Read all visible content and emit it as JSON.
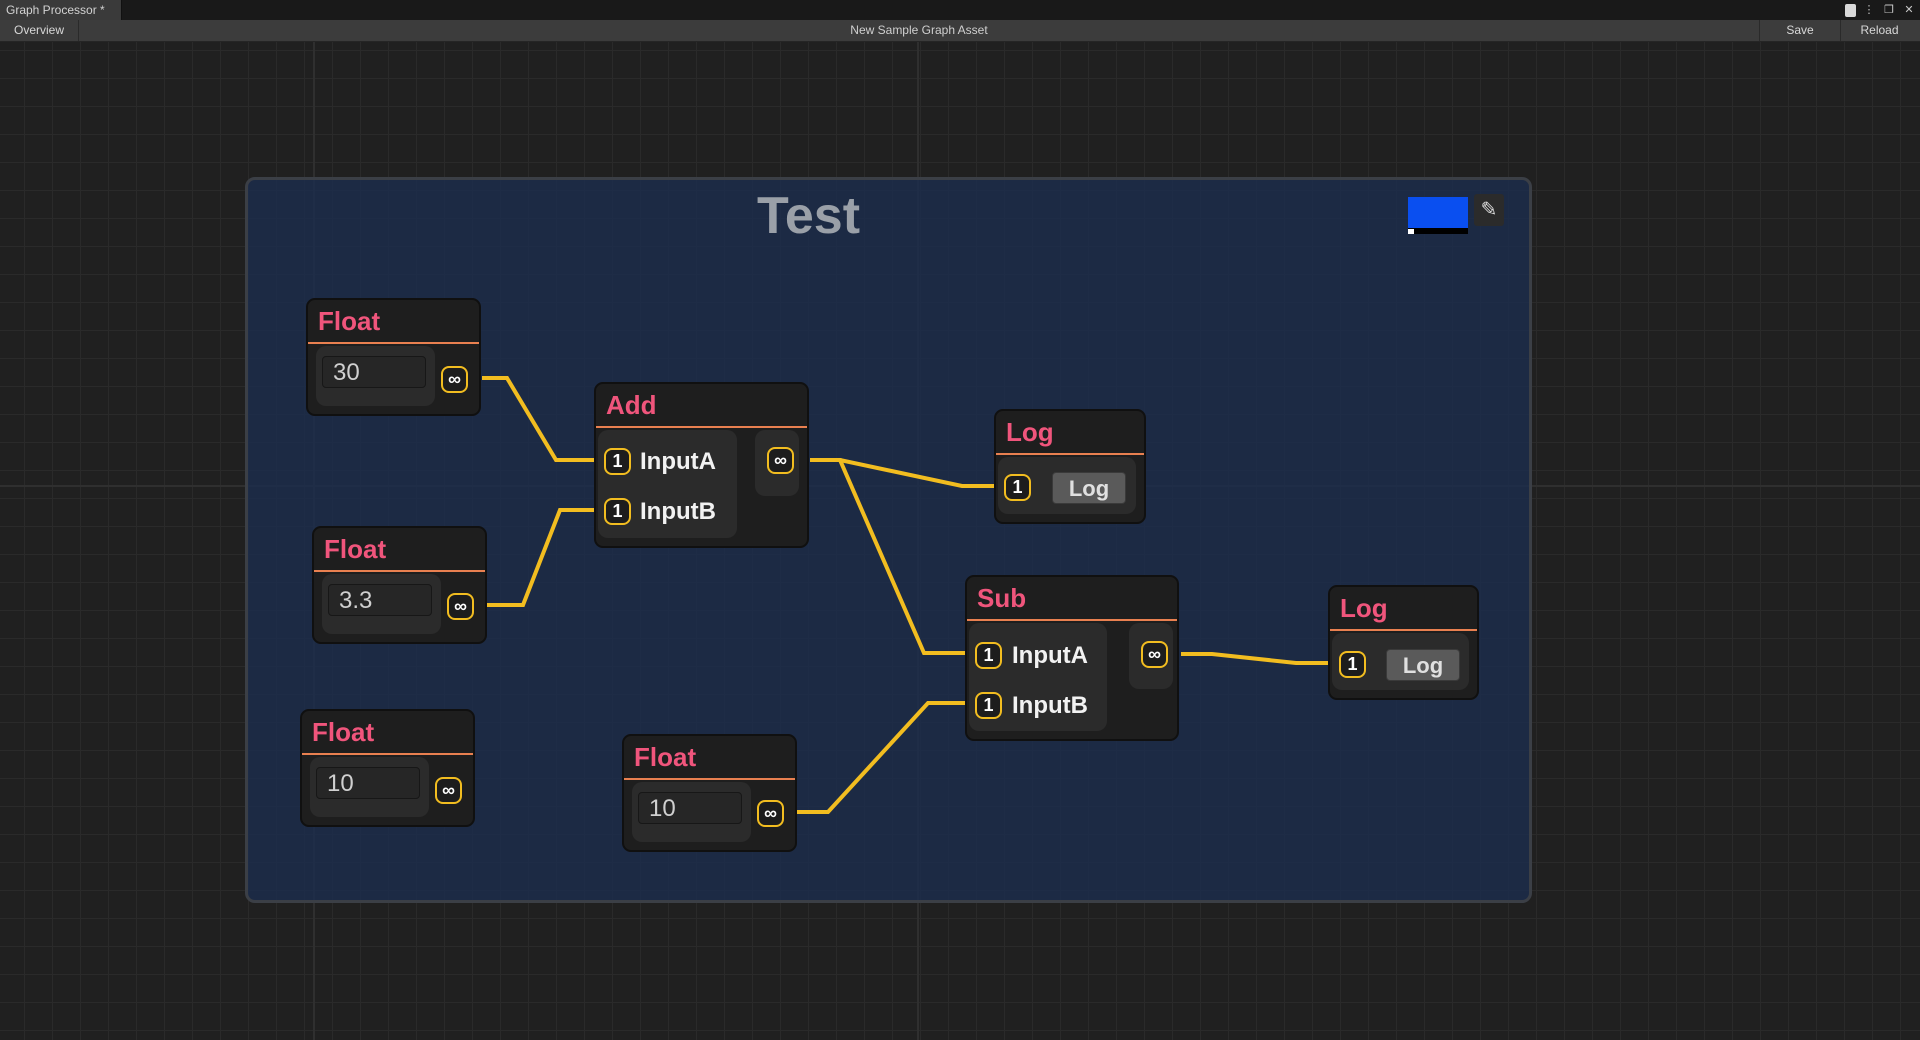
{
  "window": {
    "tab_title": "Graph Processor *"
  },
  "toolbar": {
    "overview_label": "Overview",
    "asset_title": "New Sample Graph Asset",
    "save_label": "Save",
    "reload_label": "Reload"
  },
  "group": {
    "title": "Test",
    "color": "#0a4ff0"
  },
  "nodes": {
    "float1": {
      "title": "Float",
      "value": "30"
    },
    "float2": {
      "title": "Float",
      "value": "3.3"
    },
    "float3": {
      "title": "Float",
      "value": "10"
    },
    "float4": {
      "title": "Float",
      "value": "10"
    },
    "add": {
      "title": "Add",
      "input_a": "InputA",
      "input_b": "InputB"
    },
    "sub": {
      "title": "Sub",
      "input_a": "InputA",
      "input_b": "InputB"
    },
    "log1": {
      "title": "Log",
      "button": "Log"
    },
    "log2": {
      "title": "Log",
      "button": "Log"
    }
  },
  "port_glyphs": {
    "single": "1",
    "multi": "∞"
  },
  "colors": {
    "accent_title": "#f0557c",
    "wire": "#f2bd20",
    "header_underline": "#e98050"
  }
}
